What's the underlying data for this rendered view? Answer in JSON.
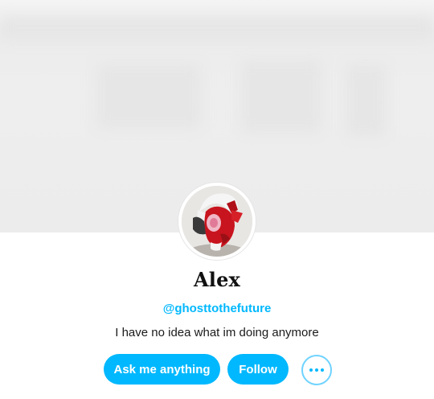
{
  "profile": {
    "name": "Alex",
    "handle": "@ghosttothefuture",
    "bio": "I have no idea what im doing anymore"
  },
  "actions": {
    "ask_label": "Ask me anything",
    "follow_label": "Follow",
    "more_icon": "more-horizontal-icon"
  },
  "colors": {
    "accent": "#00b8ff",
    "header_bg": "#ececec",
    "text": "#111111"
  }
}
